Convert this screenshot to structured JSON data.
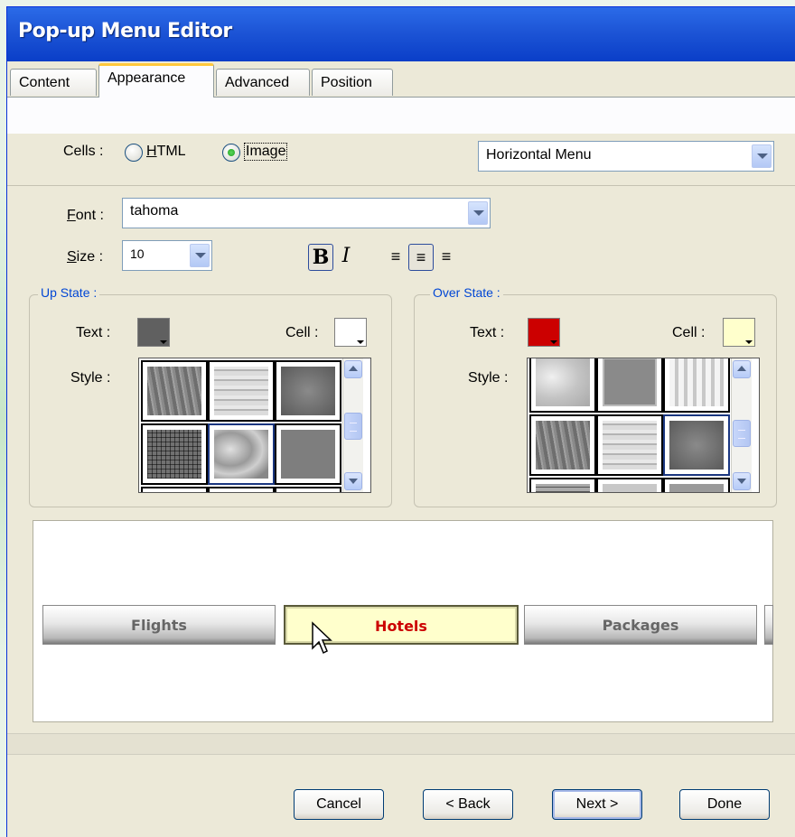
{
  "window": {
    "title": "Pop-up Menu Editor"
  },
  "tabs": [
    {
      "label": "Content",
      "active": false
    },
    {
      "label": "Appearance",
      "active": true
    },
    {
      "label": "Advanced",
      "active": false
    },
    {
      "label": "Position",
      "active": false
    }
  ],
  "cells": {
    "label": "Cells :",
    "options": [
      "HTML",
      "Image"
    ],
    "selected": "Image",
    "orientation": "Horizontal Menu"
  },
  "font": {
    "label": "Font :",
    "value": "tahoma"
  },
  "size": {
    "label": "Size :",
    "value": "10"
  },
  "format": {
    "bold": "B",
    "italic": "I",
    "alignment": "center"
  },
  "up_state": {
    "label": "Up State :",
    "text_label": "Text :",
    "cell_label": "Cell :",
    "style_label": "Style :",
    "text_color": "#606060",
    "cell_color": "#ffffff"
  },
  "over_state": {
    "label": "Over State :",
    "text_label": "Text :",
    "cell_label": "Cell :",
    "style_label": "Style :",
    "text_color": "#cc0000",
    "cell_color": "#ffffcc"
  },
  "preview": {
    "items": [
      "Flights",
      "Hotels",
      "Packages"
    ],
    "hovered": "Hotels"
  },
  "buttons": {
    "cancel": "Cancel",
    "back": "< Back",
    "next": "Next >",
    "done": "Done"
  }
}
